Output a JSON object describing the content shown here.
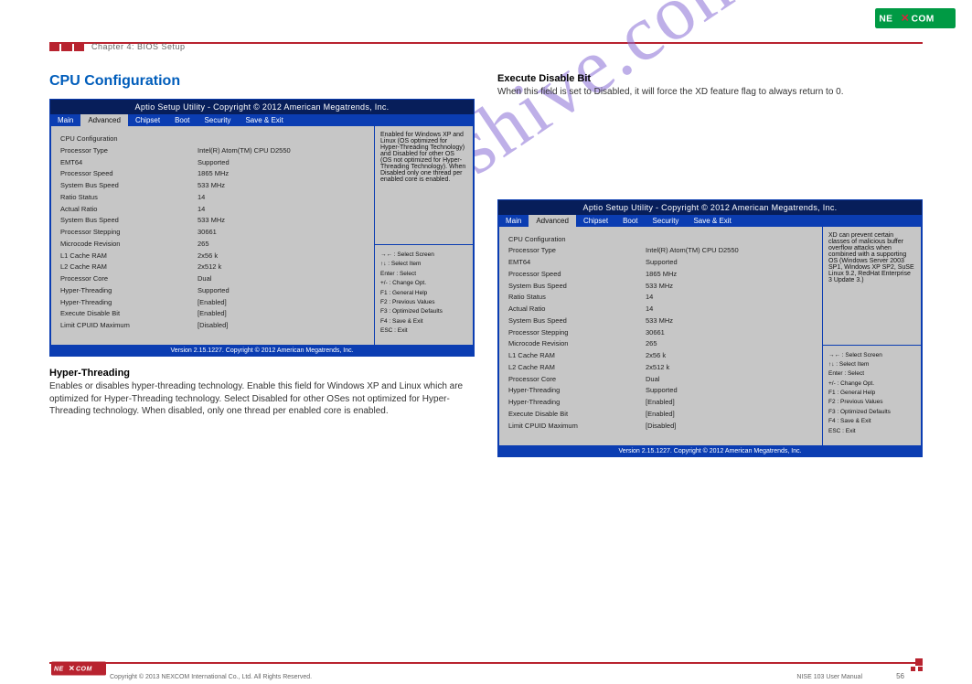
{
  "header": {
    "chapter": "Chapter 4: BIOS Setup",
    "logo_text": "NE COM",
    "logo_accent": "✕"
  },
  "left_panel": {
    "heading": "CPU Configuration",
    "bios": {
      "title": "Aptio Setup Utility - Copyright © 2012 American Megatrends, Inc.",
      "tabs": [
        "Main",
        "Advanced",
        "Chipset",
        "Boot",
        "Security",
        "Save & Exit"
      ],
      "active_tab": "Advanced",
      "main_rows": [
        {
          "k": "CPU Configuration",
          "v": ""
        },
        {
          "k": "",
          "v": ""
        },
        {
          "k": "Processor Type",
          "v": "Intel(R) Atom(TM) CPU D2550"
        },
        {
          "k": "EMT64",
          "v": "Supported"
        },
        {
          "k": "Processor Speed",
          "v": "1865 MHz"
        },
        {
          "k": "System Bus Speed",
          "v": "533 MHz"
        },
        {
          "k": "Ratio Status",
          "v": "14"
        },
        {
          "k": "Actual Ratio",
          "v": "14"
        },
        {
          "k": "System Bus Speed",
          "v": "533 MHz"
        },
        {
          "k": "Processor Stepping",
          "v": "30661"
        },
        {
          "k": "Microcode Revision",
          "v": "265"
        },
        {
          "k": "L1 Cache RAM",
          "v": "2x56 k"
        },
        {
          "k": "L2 Cache RAM",
          "v": "2x512 k"
        },
        {
          "k": "Processor Core",
          "v": "Dual"
        },
        {
          "k": "Hyper-Threading",
          "v": "Supported"
        },
        {
          "k": "",
          "v": ""
        },
        {
          "k": "Hyper-Threading",
          "v": "[Enabled]"
        },
        {
          "k": "Execute Disable Bit",
          "v": "[Enabled]"
        },
        {
          "k": "Limit CPUID Maximum",
          "v": "[Disabled]"
        }
      ],
      "help_text": "Enabled for Windows XP and Linux (OS optimized for Hyper-Threading Technology) and Disabled for other OS (OS not optimized for Hyper-Threading Technology). When Disabled only one thread per enabled core is enabled.",
      "keys": [
        "→← : Select Screen",
        "↑↓ : Select Item",
        "Enter : Select",
        "+/- : Change Opt.",
        "F1 : General Help",
        "F2 : Previous Values",
        "F3 : Optimized Defaults",
        "F4 : Save & Exit",
        "ESC : Exit"
      ],
      "footer": "Version 2.15.1227. Copyright © 2012 American Megatrends, Inc."
    },
    "field": {
      "name": "Hyper-Threading",
      "desc": "Enables or disables hyper-threading technology. Enable this field for Windows XP and Linux which are optimized for Hyper-Threading technology. Select Disabled for other OSes not optimized for Hyper-Threading technology. When disabled, only one thread per enabled core is enabled."
    }
  },
  "right_panel": {
    "intro_field": {
      "name": "Execute Disable Bit",
      "desc": "When this field is set to Disabled, it will force the XD feature flag to always return to 0."
    },
    "bios": {
      "title": "Aptio Setup Utility - Copyright © 2012 American Megatrends, Inc.",
      "tabs": [
        "Main",
        "Advanced",
        "Chipset",
        "Boot",
        "Security",
        "Save & Exit"
      ],
      "active_tab": "Advanced",
      "main_rows": [
        {
          "k": "CPU Configuration",
          "v": ""
        },
        {
          "k": "",
          "v": ""
        },
        {
          "k": "Processor Type",
          "v": "Intel(R) Atom(TM) CPU D2550"
        },
        {
          "k": "EMT64",
          "v": "Supported"
        },
        {
          "k": "Processor Speed",
          "v": "1865 MHz"
        },
        {
          "k": "System Bus Speed",
          "v": "533 MHz"
        },
        {
          "k": "Ratio Status",
          "v": "14"
        },
        {
          "k": "Actual Ratio",
          "v": "14"
        },
        {
          "k": "System Bus Speed",
          "v": "533 MHz"
        },
        {
          "k": "Processor Stepping",
          "v": "30661"
        },
        {
          "k": "Microcode Revision",
          "v": "265"
        },
        {
          "k": "L1 Cache RAM",
          "v": "2x56 k"
        },
        {
          "k": "L2 Cache RAM",
          "v": "2x512 k"
        },
        {
          "k": "Processor Core",
          "v": "Dual"
        },
        {
          "k": "Hyper-Threading",
          "v": "Supported"
        },
        {
          "k": "",
          "v": ""
        },
        {
          "k": "Hyper-Threading",
          "v": "[Enabled]"
        },
        {
          "k": "Execute Disable Bit",
          "v": "[Enabled]"
        },
        {
          "k": "Limit CPUID Maximum",
          "v": "[Disabled]"
        }
      ],
      "help_text": "XD can prevent certain classes of malicious buffer overflow attacks when combined with a supporting OS (Windows Server 2003 SP1, Windows XP SP2, SuSE Linux 9.2, RedHat Enterprise 3 Update 3.)",
      "keys": [
        "→← : Select Screen",
        "↑↓ : Select Item",
        "Enter : Select",
        "+/- : Change Opt.",
        "F1 : General Help",
        "F2 : Previous Values",
        "F3 : Optimized Defaults",
        "F4 : Save & Exit",
        "ESC : Exit"
      ],
      "footer": "Version 2.15.1227. Copyright © 2012 American Megatrends, Inc."
    }
  },
  "footer": {
    "copyright": "Copyright © 2013 NEXCOM International Co., Ltd. All Rights Reserved.",
    "page": "56",
    "product": "NISE 103 User Manual",
    "logo": "NE COM"
  },
  "watermark": "manualshive.com"
}
